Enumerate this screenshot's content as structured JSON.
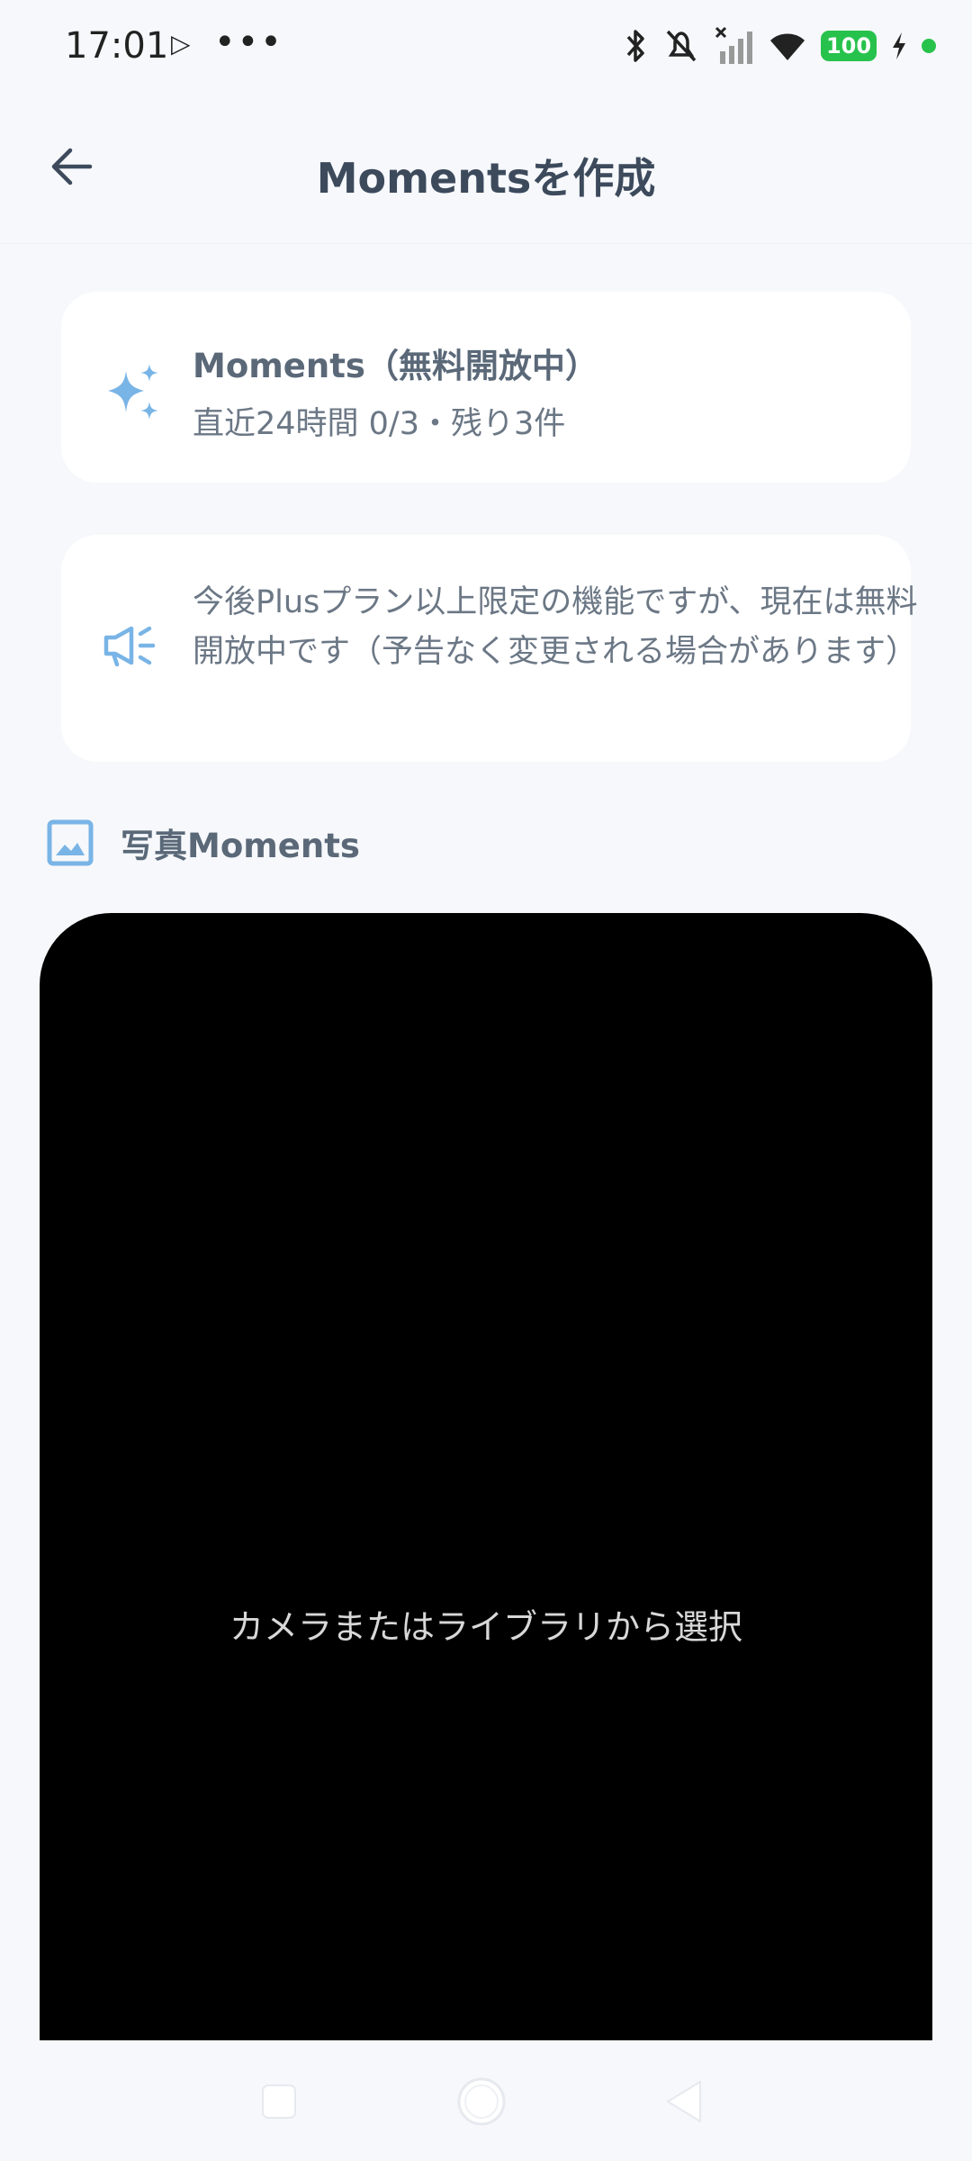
{
  "status_bar": {
    "time": "17:01",
    "media_icon": "play-icon",
    "overflow": "•••",
    "battery": "100",
    "colors": {
      "battery": "#27c24c",
      "dot": "#27c24c"
    }
  },
  "header": {
    "title": "Momentsを作成",
    "back_icon": "arrow-left-icon"
  },
  "quota_card": {
    "title": "Moments（無料開放中）",
    "subtitle": "直近24時間 0/3・残り3件",
    "icon": "sparkles-icon"
  },
  "notice_card": {
    "text": "今後Plusプラン以上限定の機能ですが、現在は無料開放中です（予告なく変更される場合があります）",
    "icon": "megaphone-icon"
  },
  "section": {
    "title": "写真Moments",
    "icon": "image-icon"
  },
  "photo_picker": {
    "label": "カメラまたはライブラリから選択"
  },
  "colors": {
    "accent": "#79b4e6",
    "background": "#f6f8fb",
    "text_primary": "#3c4a5c",
    "text_secondary": "#6b7785"
  }
}
